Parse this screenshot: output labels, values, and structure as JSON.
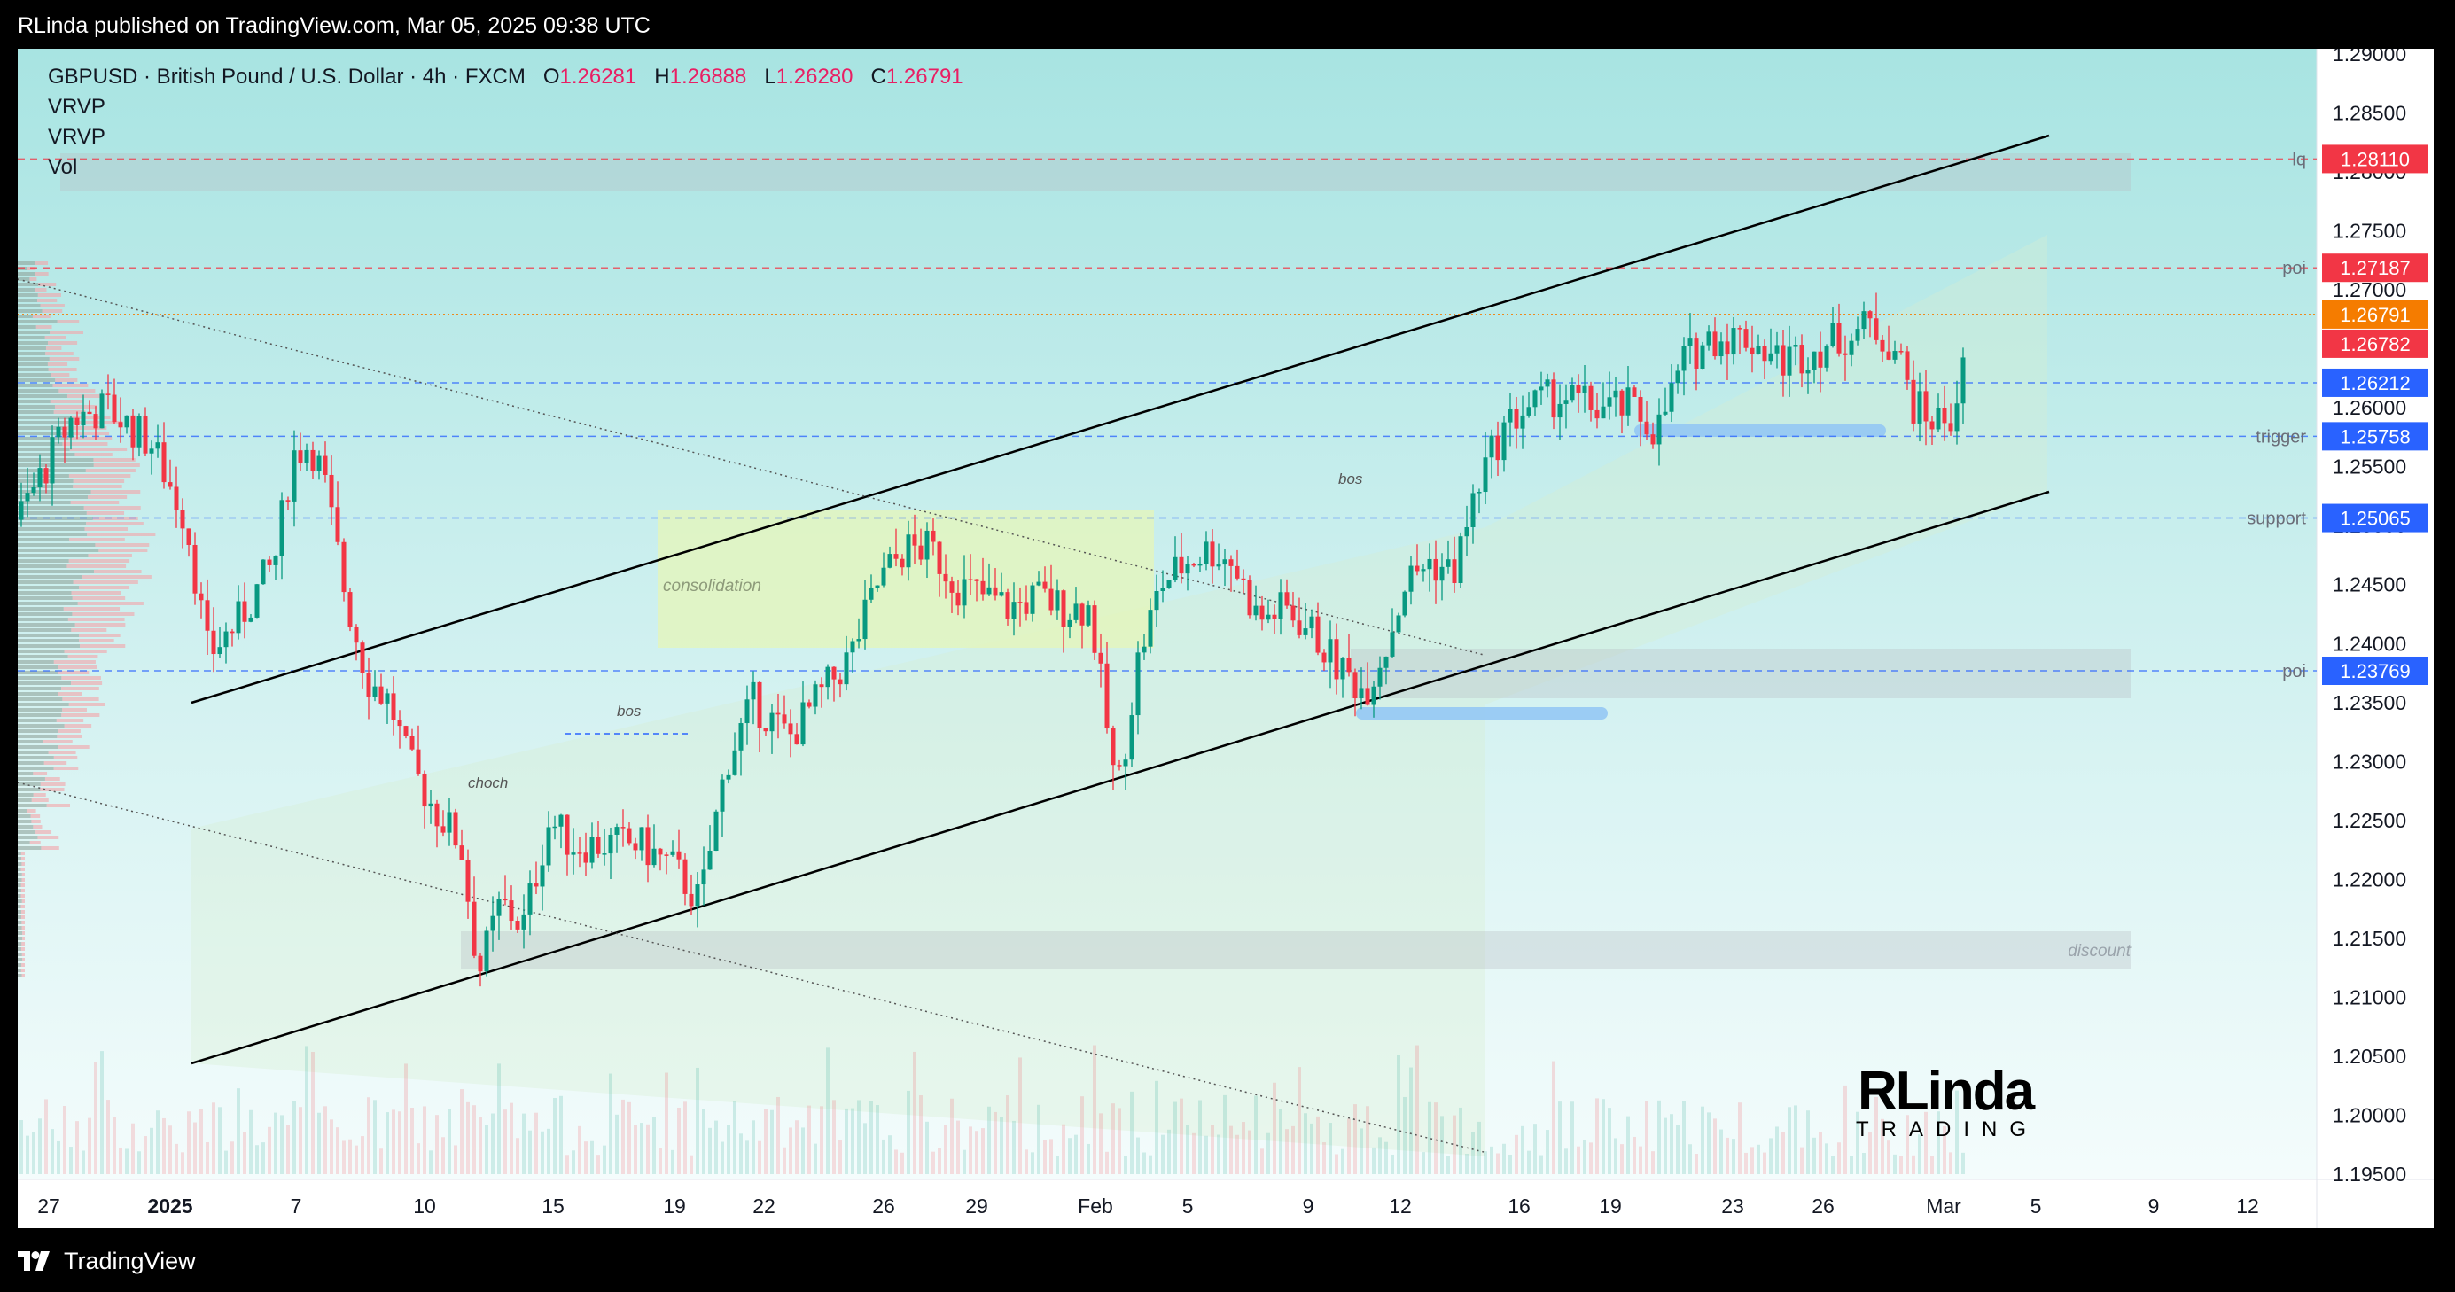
{
  "published_by": "RLinda published on TradingView.com, Mar 05, 2025 09:38 UTC",
  "brand_label": "TradingView",
  "symbol_header": {
    "symbol": "GBPUSD · British Pound / U.S. Dollar · 4h · FXCM",
    "o_label": "O",
    "o": "1.26281",
    "h_label": "H",
    "h": "1.26888",
    "l_label": "L",
    "l": "1.26280",
    "c_label": "C",
    "c": "1.26791"
  },
  "indicators": [
    "VRVP",
    "VRVP",
    "Vol"
  ],
  "price_axis_ticks": [
    "1.29000",
    "1.28500",
    "1.28000",
    "1.27500",
    "1.27000",
    "1.26500",
    "1.26000",
    "1.25500",
    "1.25000",
    "1.24500",
    "1.24000",
    "1.23500",
    "1.23000",
    "1.22500",
    "1.22000",
    "1.21500",
    "1.21000",
    "1.20500",
    "1.20000",
    "1.19500"
  ],
  "time_axis_ticks": [
    "27",
    "2025",
    "7",
    "10",
    "15",
    "19",
    "22",
    "26",
    "29",
    "Feb",
    "5",
    "9",
    "12",
    "16",
    "19",
    "23",
    "26",
    "Mar",
    "5",
    "9",
    "12"
  ],
  "price_levels": [
    {
      "price": 1.2811,
      "label": "lq",
      "tag": "1.28110",
      "color": "#f23645"
    },
    {
      "price": 1.27187,
      "label": "poi",
      "tag": "1.27187",
      "color": "#f23645"
    },
    {
      "price": 1.26212,
      "label": "",
      "tag": "1.26212",
      "color": "#2962ff"
    },
    {
      "price": 1.25758,
      "label": "trigger",
      "tag": "1.25758",
      "color": "#2962ff"
    },
    {
      "price": 1.25065,
      "label": "support",
      "tag": "1.25065",
      "color": "#2962ff"
    },
    {
      "price": 1.23769,
      "label": "poi",
      "tag": "1.23769",
      "color": "#2962ff"
    }
  ],
  "last_price_tag": "1.26791",
  "countdown_tag": "1.26782",
  "annotations": {
    "consolidation": "consolidation",
    "bos1": "bos",
    "bos2": "bos",
    "choch": "choch",
    "discount": "discount"
  },
  "watermark": {
    "top": "RLinda",
    "bottom": "TRADING"
  },
  "colors": {
    "up": "#089981",
    "down": "#f23645",
    "accent_orange": "#f57c00"
  }
}
